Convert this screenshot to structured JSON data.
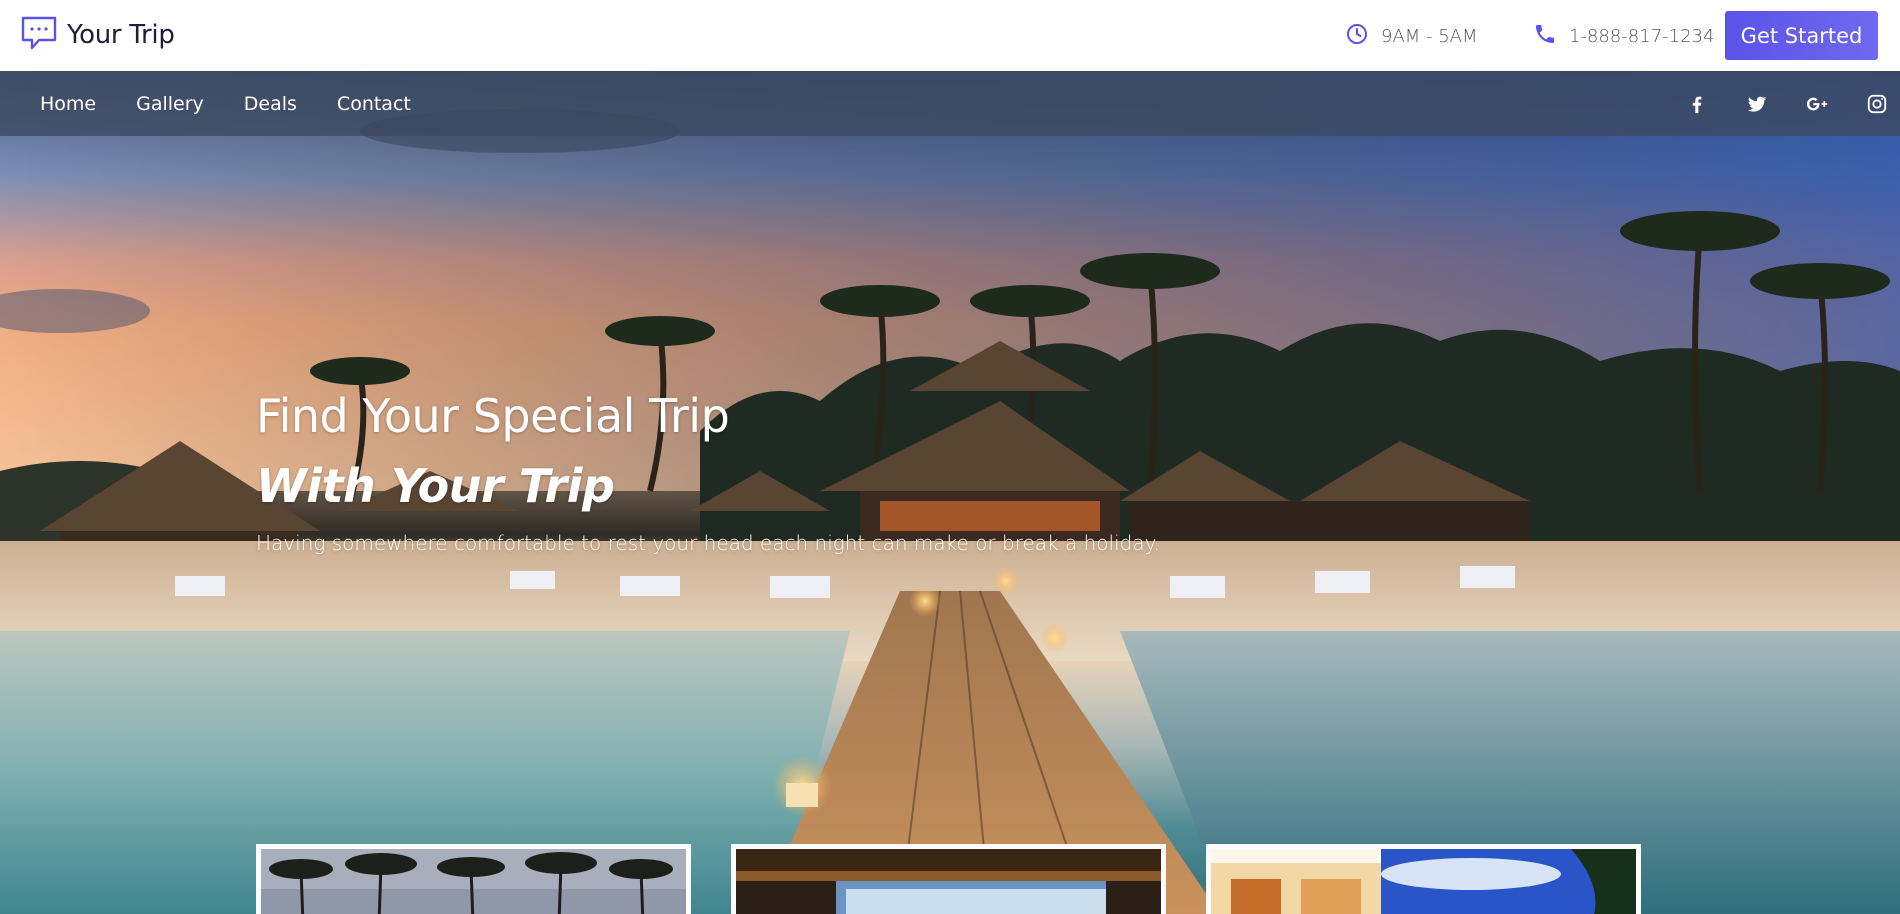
{
  "brand": {
    "name": "Your Trip",
    "accent": "#5b52e8"
  },
  "header": {
    "hours": "9AM - 5AM",
    "phone": "1-888-817-1234",
    "cta_label": "Get Started",
    "icons": {
      "hours": "clock-icon",
      "phone": "phone-icon",
      "logo": "chat-bubble-icon"
    }
  },
  "nav": {
    "items": [
      {
        "label": "Home"
      },
      {
        "label": "Gallery"
      },
      {
        "label": "Deals"
      },
      {
        "label": "Contact"
      }
    ],
    "social": [
      "facebook-icon",
      "twitter-icon",
      "google-plus-icon",
      "instagram-icon"
    ]
  },
  "hero": {
    "title": "Find Your Special Trip",
    "subtitle": "With Your Trip",
    "description": "Having somewhere comfortable to rest your head each night can make or break a holiday."
  },
  "cards": [
    {
      "scene": "palm-trees-sunset"
    },
    {
      "scene": "resort-pavilion"
    },
    {
      "scene": "beach-resort-blue-sky"
    }
  ]
}
